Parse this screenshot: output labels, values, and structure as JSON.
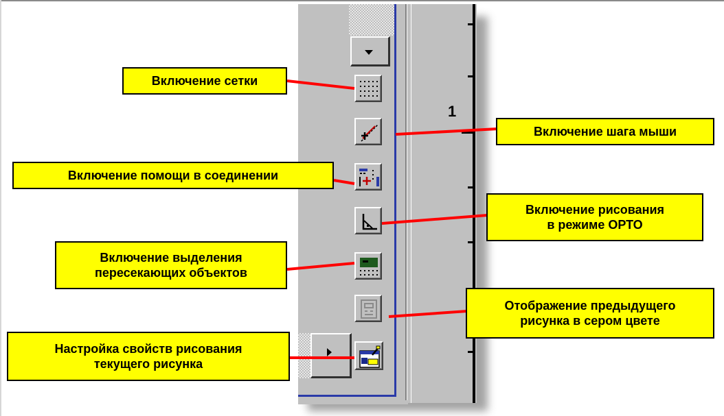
{
  "labels": {
    "grid": "Включение сетки",
    "snap": "Включение шага мыши",
    "connect_help": "Включение помощи в соединении",
    "ortho_line1": "Включение рисования",
    "ortho_line2": "в режиме ОРТО",
    "intersect_line1": "Включение выделения",
    "intersect_line2": "пересекающих объектов",
    "prev_gray_line1": "Отображение предыдущего",
    "prev_gray_line2": "рисунка в сером цвете",
    "props_line1": "Настройка свойств рисования",
    "props_line2": "текущего рисунка"
  },
  "ruler": {
    "number": "1"
  },
  "colors": {
    "callout_bg": "#ffff00",
    "leader_line": "#ff0000",
    "panel_bg": "#c0c0c0",
    "accent_blue": "#2a3aa8"
  },
  "icons": {
    "dropdown": "dropdown-arrow-icon",
    "grid": "grid-icon",
    "snap": "snap-icon",
    "connect": "connect-help-icon",
    "ortho": "ortho-icon",
    "intersect": "intersect-select-icon",
    "prev_gray": "previous-drawing-gray-icon",
    "props": "drawing-properties-icon",
    "scroll": "scroll-right-icon"
  }
}
